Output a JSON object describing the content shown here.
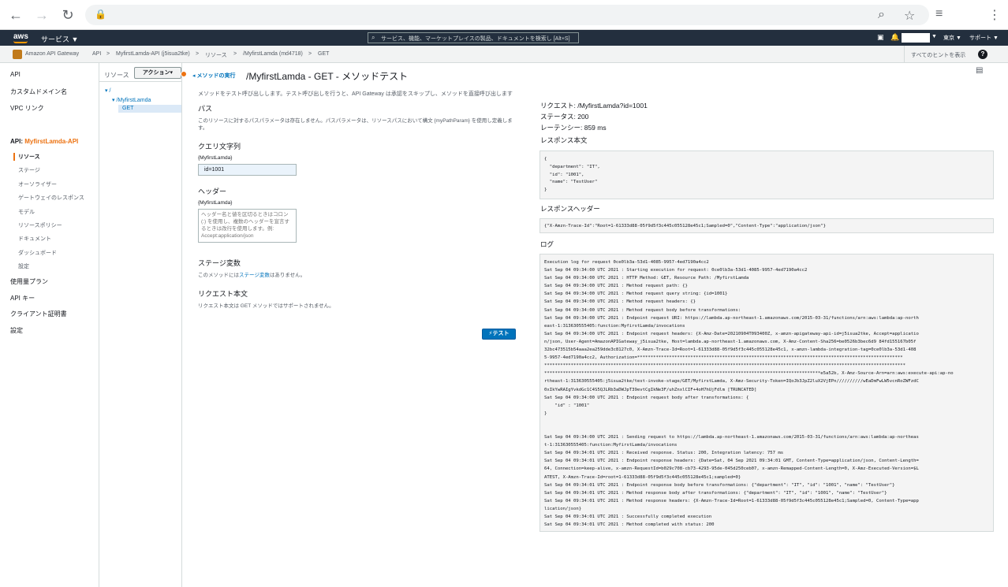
{
  "browser": {
    "back": "←",
    "forward": "→",
    "reload": "↻",
    "lock": "🔒",
    "zoom": "⌕",
    "star": "☆",
    "playlist": "≡",
    "menu": "⋮"
  },
  "aws": {
    "logo": "aws",
    "services": "サービス ▼",
    "search_placeholder": "サービス、機能、マーケットプレイスの製品、ドキュメントを検索し    [Alt+S]",
    "region": "東京 ▼",
    "support": "サポート ▼",
    "user_caret": "▼"
  },
  "breadcrumb": {
    "service": "Amazon API Gateway",
    "items": [
      "API",
      ">",
      "MyfirstLamda-API (j5isua2tke)",
      ">",
      "リソース",
      ">",
      "/MyfirstLamda (md4718)",
      ">",
      "GET"
    ],
    "hints": "すべてのヒントを表示",
    "help": "?"
  },
  "leftnav": {
    "top": [
      "API",
      "カスタムドメイン名",
      "VPC リンク"
    ],
    "api_prefix": "API:",
    "api_name": "MyfirstLamda-API",
    "sub": [
      "リソース",
      "ステージ",
      "オーソライザー",
      "ゲートウェイのレスポンス",
      "モデル",
      "リソースポリシー",
      "ドキュメント",
      "ダッシュボード",
      "設定"
    ],
    "bottom": [
      "使用量プラン",
      "API キー",
      "クライアント証明書",
      "設定"
    ]
  },
  "resources": {
    "title": "リソース",
    "actions": "アクション▾",
    "tree": [
      "▾ /",
      "▾ /MyfirstLamda",
      "GET"
    ]
  },
  "main": {
    "back": "◂ メソッドの実行",
    "title": "/MyfirstLamda - GET - メソッドテスト",
    "description": "メソッドをテスト呼び出しします。テスト呼び出しを行うと、API Gateway は承認をスキップし、メソッドを直接呼び出します",
    "path_heading": "パス",
    "path_text": "このリソースに対するパスパラメータは存在しません。パスパラメータは、リソースパスにおいて構文 {myPathParam} を使用し定義します。",
    "query_heading": "クエリ文字列",
    "query_label": "{MyfirstLamda}",
    "query_value": "id=1001",
    "header_heading": "ヘッダー",
    "header_label": "{MyfirstLamda}",
    "header_placeholder": "ヘッダー名と値を区切るときはコロン (:) を使用し、複数のヘッダーを宣言するときは改行を使用します。例: Accept:application/json",
    "stage_heading": "ステージ変数",
    "stage_text_1": "このメソッドには",
    "stage_link": "ステージ変数",
    "stage_text_2": "はありません。",
    "body_heading": "リクエスト本文",
    "body_text": "リクエスト本文は GET メソッドではサポートされません。",
    "test_button": "⚡テスト"
  },
  "result": {
    "request": "リクエスト: /MyfirstLamda?id=1001",
    "status": "ステータス: 200",
    "latency": "レーテンシー: 859 ms",
    "body_heading": "レスポンス本文",
    "body": "{\n  \"department\": \"IT\",\n  \"id\": \"1001\",\n  \"name\": \"TestUser\"\n}",
    "headers_heading": "レスポンスヘッダー",
    "headers": "{\"X-Amzn-Trace-Id\":\"Root=1-61333d88-05f9d5f3c445c055128e45c1;Sampled=0\",\"Content-Type\":\"application/json\"}",
    "log_heading": "ログ",
    "log": "Execution log for request 0ce0lb3a-53d1-4085-9957-4ed7190a4cc2\nSat Sep 04 09:34:00 UTC 2021 : Starting execution for request: 0ce0lb3a-53d1-4085-9957-4ed7190a4cc2\nSat Sep 04 09:34:00 UTC 2021 : HTTP Method: GET, Resource Path: /MyfirstLamda\nSat Sep 04 09:34:00 UTC 2021 : Method request path: {}\nSat Sep 04 09:34:00 UTC 2021 : Method request query string: {id=1001}\nSat Sep 04 09:34:00 UTC 2021 : Method request headers: {}\nSat Sep 04 09:34:00 UTC 2021 : Method request body before transformations:\nSat Sep 04 09:34:00 UTC 2021 : Endpoint request URI: https://lambda.ap-northeast-1.amazonaws.com/2015-03-31/functions/arn:aws:lambda:ap-north\neast-1:313630555405:function:MyfirstLamda/invocations\nSat Sep 04 09:34:00 UTC 2021 : Endpoint request headers: {X-Amz-Date=20210904T093400Z, x-amzn-apigateway-api-id=j5isua2tke, Accept=applicatio\nn/json, User-Agent=AmazonAPIGateway_j5isua2tke, Host=lambda.ap-northeast-1.amazonaws.com, X-Amz-Content-Sha256=be0526b3bec6d9 84fd155167b05f\n32bc473515b54aaa2ea259dde3c8127c0, X-Amzn-Trace-Id=Root=1-61333d88-05f9d5f3c445c055128e45c1, x-amzn-lambda-integration-tag=0ce0lb3a-53d1-408\n5-9957-4ed7190a4cc2, Authorization=****************************************************************************************************\n****************************************************************************************************************************************\n********************************************************************************************************e5a52b, X-Amz-Source-Arn=arn:aws:execute-api:ap-no\nrtheast-1:313630555405:j5isua2tke/test-invoke-stage/GET/MyfirstLamda, X-Amz-Security-Token=IQoJb3JpZ2luX2VjEPn//////////wEaDmFwLW5vcnRoZWFzdC\n0xIkYwRAIgYvkdGc1C4S5QJLRb3aDWJpT39evtCgIkNe3F/uhZnxlCIF+4oH7hUjFdlm [TRUNCATED]\nSat Sep 04 09:34:00 UTC 2021 : Endpoint request body after transformations: {\n    \"id\" : \"1001\"\n}\n\n\nSat Sep 04 09:34:00 UTC 2021 : Sending request to https://lambda.ap-northeast-1.amazonaws.com/2015-03-31/functions/arn:aws:lambda:ap-northeas\nt-1:313630555405:function:MyfirstLamda/invocations\nSat Sep 04 09:34:01 UTC 2021 : Received response. Status: 200, Integration latency: 757 ms\nSat Sep 04 09:34:01 UTC 2021 : Endpoint response headers: {Date=Sat, 04 Sep 2021 09:34:01 GMT, Content-Type=application/json, Content-Length=\n64, Connection=keep-alive, x-amzn-RequestId=b029c708-cb73-4293-95de-045d250ceb07, x-amzn-Remapped-Content-Length=0, X-Amz-Executed-Version=$L\nATEST, X-Amzn-Trace-Id=root=1-61333d88-05f9d5f3c445c055128e45c1;sampled=0}\nSat Sep 04 09:34:01 UTC 2021 : Endpoint response body before transformations: {\"department\": \"IT\", \"id\": \"1001\", \"name\": \"TestUser\"}\nSat Sep 04 09:34:01 UTC 2021 : Method response body after transformations: {\"department\": \"IT\", \"id\": \"1001\", \"name\": \"TestUser\"}\nSat Sep 04 09:34:01 UTC 2021 : Method response headers: {X-Amzn-Trace-Id=Root=1-61333d88-05f9d5f3c445c055128e45c1;Sampled=0, Content-Type=app\nlication/json}\nSat Sep 04 09:34:01 UTC 2021 : Successfully completed execution\nSat Sep 04 09:34:01 UTC 2021 : Method completed with status: 200"
  }
}
